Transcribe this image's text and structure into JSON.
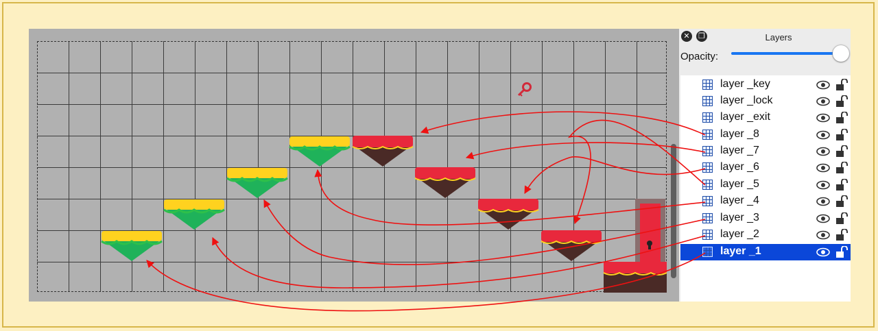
{
  "layers_panel": {
    "title": "Layers",
    "opacity_label": "Opacity:",
    "opacity_value": 1.0,
    "close_icon": "close-icon",
    "float_icon": "float-window-icon",
    "layers": [
      {
        "name": "layer _key",
        "visible": true,
        "locked": false,
        "selected": false
      },
      {
        "name": "layer _lock",
        "visible": true,
        "locked": false,
        "selected": false
      },
      {
        "name": "layer _exit",
        "visible": true,
        "locked": false,
        "selected": false
      },
      {
        "name": "layer _8",
        "visible": true,
        "locked": false,
        "selected": false
      },
      {
        "name": "layer _7",
        "visible": true,
        "locked": false,
        "selected": false
      },
      {
        "name": "layer _6",
        "visible": true,
        "locked": false,
        "selected": false
      },
      {
        "name": "layer _5",
        "visible": true,
        "locked": false,
        "selected": false
      },
      {
        "name": "layer _4",
        "visible": true,
        "locked": false,
        "selected": false
      },
      {
        "name": "layer _3",
        "visible": true,
        "locked": false,
        "selected": false
      },
      {
        "name": "layer _2",
        "visible": true,
        "locked": false,
        "selected": false
      },
      {
        "name": "layer _1",
        "visible": true,
        "locked": false,
        "selected": true
      }
    ]
  },
  "colors": {
    "arrow": "#ee1111",
    "green_platform_top": "#ffd21f",
    "green_platform_body": "#1fb25a",
    "red_platform_top": "#e8283c",
    "red_platform_body": "#4a2a26",
    "selection": "#0b47d9"
  }
}
